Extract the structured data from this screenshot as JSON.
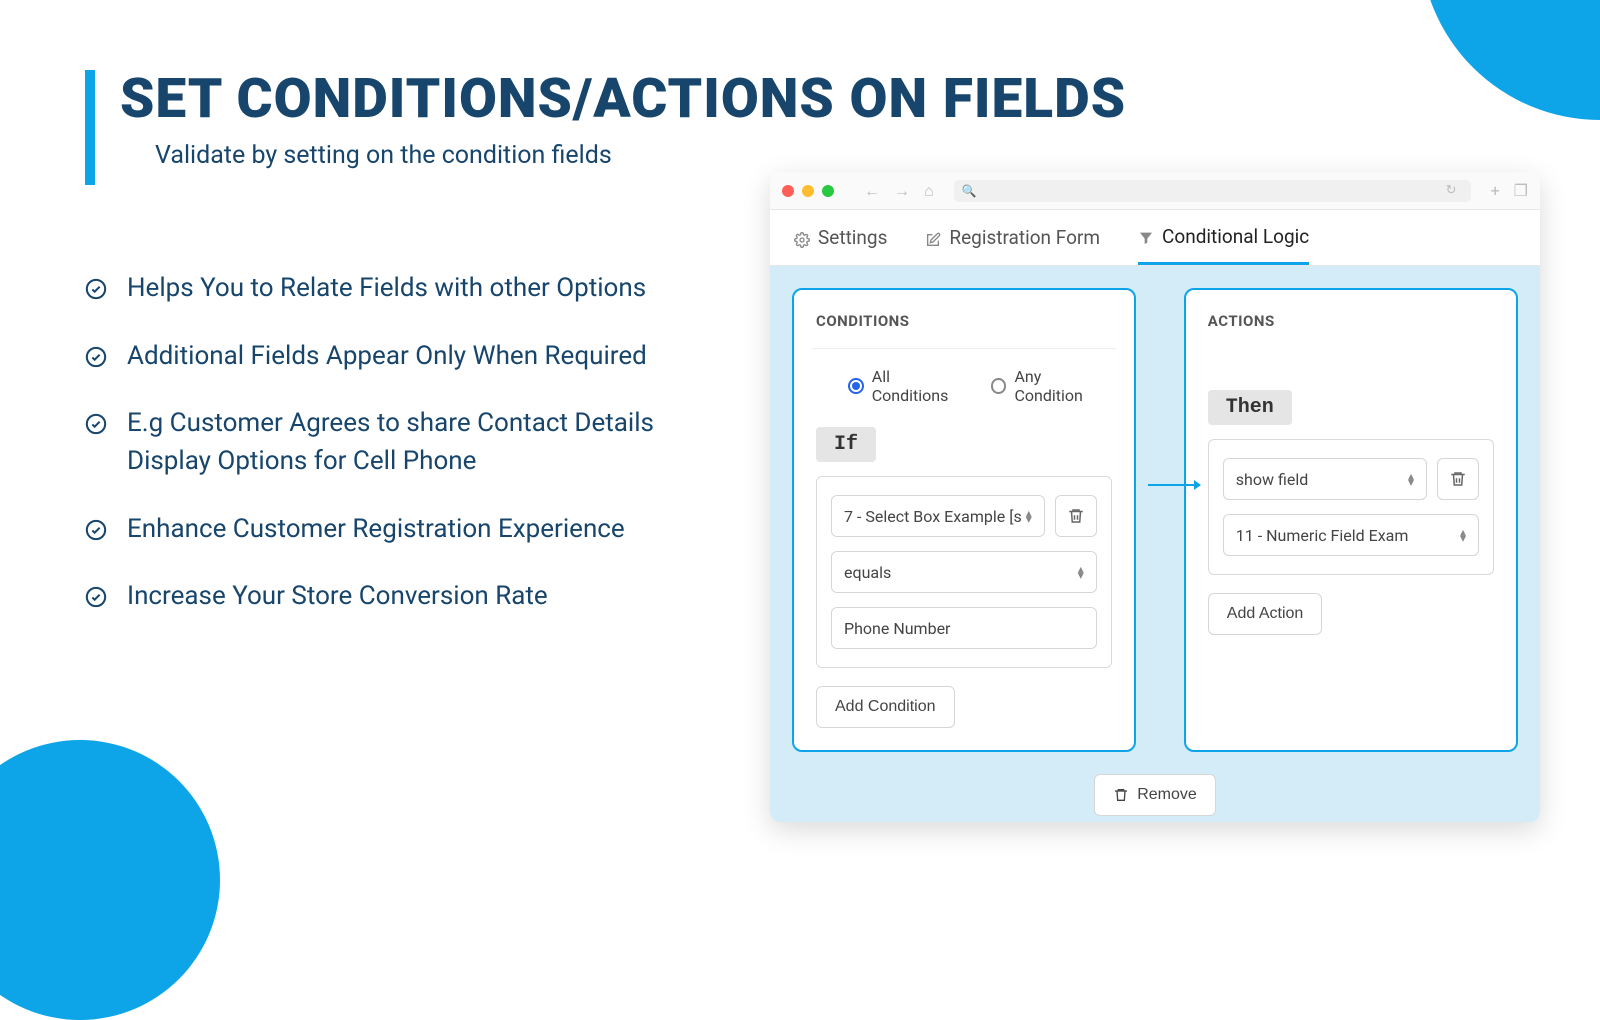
{
  "heading": {
    "title": "SET CONDITIONS/ACTIONS ON FIELDS",
    "subtitle": "Validate by setting on the condition fields"
  },
  "bullets": [
    "Helps You to Relate Fields with other Options",
    "Additional Fields Appear Only When Required",
    "E.g Customer Agrees to share Contact Details Display Options for Cell Phone",
    "Enhance Customer Registration Experience",
    "Increase Your Store Conversion Rate"
  ],
  "tabs": {
    "settings": "Settings",
    "registration": "Registration Form",
    "conditional": "Conditional Logic"
  },
  "conditions": {
    "title": "CONDITIONS",
    "all_label": "All Conditions",
    "any_label": "Any Condition",
    "keyword": "If",
    "field_select": "7 - Select Box Example [s",
    "operator": "equals",
    "value": "Phone Number",
    "add_label": "Add Condition"
  },
  "actions": {
    "title": "ACTIONS",
    "keyword": "Then",
    "action_select": "show field",
    "target_select": "11 - Numeric Field Exam",
    "add_label": "Add Action"
  },
  "remove_label": "Remove"
}
